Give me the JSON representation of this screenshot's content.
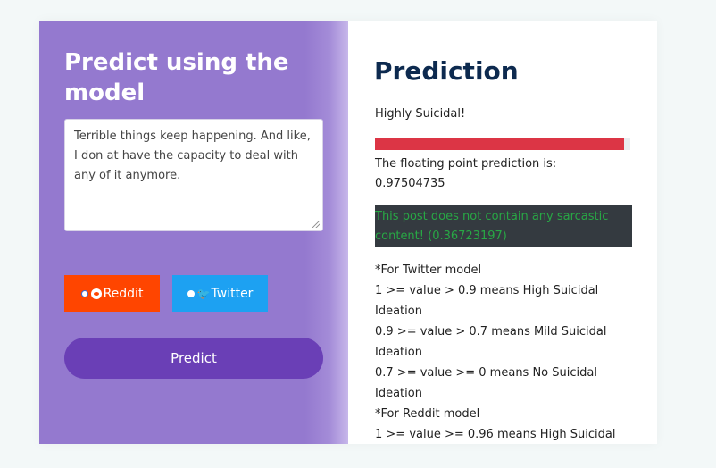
{
  "left": {
    "title": "Predict using the model",
    "input_text": "Terrible things keep happening. And like, I don at have the capacity to deal with any of it anymore.",
    "reddit_label": "Reddit",
    "twitter_label": "Twitter",
    "predict_label": "Predict"
  },
  "right": {
    "title": "Prediction",
    "result_label": "Highly Suicidal!",
    "bar_level": 0.97504735,
    "float_label": "The floating point prediction is:",
    "float_value": "0.97504735",
    "sarcasm_text": "This post does not contain any sarcastic content! (0.36723197)",
    "legend_lines": [
      "*For Twitter model",
      "1 >= value > 0.9 means High Suicidal Ideation",
      "0.9 >= value > 0.7 means Mild Suicidal Ideation",
      "0.7 >= value >= 0 means No Suicidal Ideation",
      "*For Reddit model",
      "1 >= value >= 0.96 means High Suicidal"
    ]
  },
  "colors": {
    "left_panel": "#9479cf",
    "predict_button": "#6a3fb6",
    "reddit": "#ff4500",
    "twitter": "#1da1f2",
    "bar": "#dc3545",
    "title": "#0d2a4f",
    "sarcasm_bg": "#343a40",
    "sarcasm_text": "#28a745"
  },
  "icons": {
    "reddit": "reddit-logo-icon",
    "twitter": "twitter-bird-icon"
  }
}
